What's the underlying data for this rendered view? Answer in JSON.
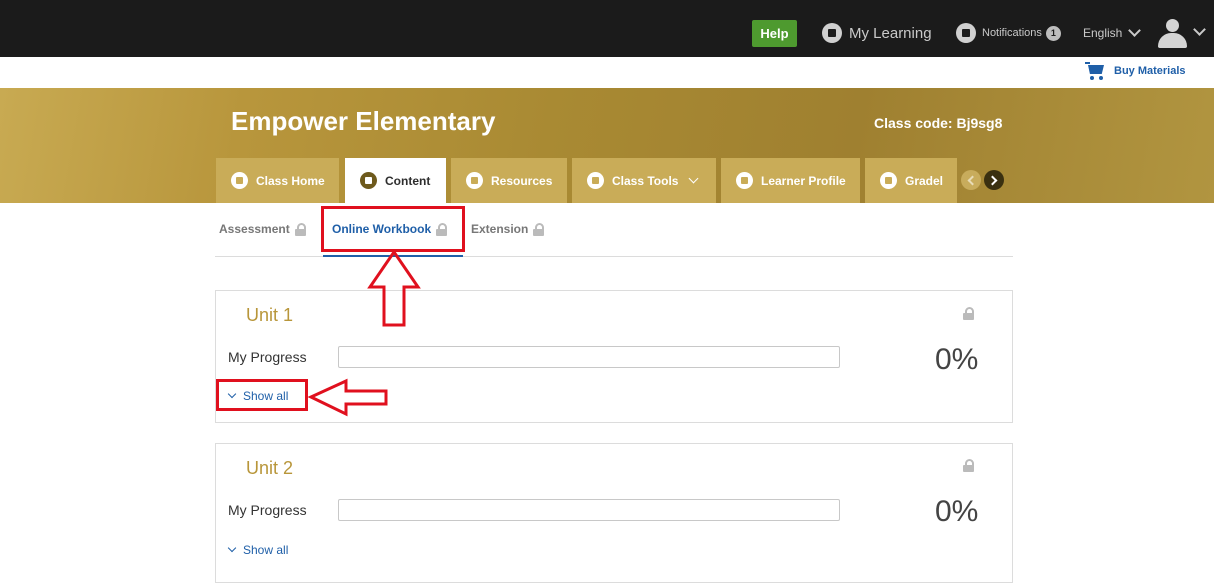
{
  "topbar": {
    "help_label": "Help",
    "mylearning_label": "My Learning",
    "notifications_label": "Notifications",
    "notifications_count": "1",
    "language_label": "English"
  },
  "buy_materials_label": "Buy Materials",
  "class": {
    "title": "Empower Elementary",
    "code_label": "Class code: Bj9sg8"
  },
  "tabs": [
    {
      "label": "Class Home"
    },
    {
      "label": "Content"
    },
    {
      "label": "Resources"
    },
    {
      "label": "Class Tools"
    },
    {
      "label": "Learner Profile"
    },
    {
      "label": "Gradel"
    }
  ],
  "subtabs": [
    {
      "label": "Assessment"
    },
    {
      "label": "Online Workbook"
    },
    {
      "label": "Extension"
    }
  ],
  "units": [
    {
      "title": "Unit 1",
      "progress_label": "My Progress",
      "progress_value": 0,
      "percent": "0%",
      "show_all": "Show all"
    },
    {
      "title": "Unit 2",
      "progress_label": "My Progress",
      "progress_value": 0,
      "percent": "0%",
      "show_all": "Show all"
    }
  ],
  "colors": {
    "topbar": "#1b1b1b",
    "help_button": "#4e9a2f",
    "gold_accent": "#b8963a",
    "link_blue": "#1f5fa8",
    "annotation_red": "#e0101e"
  },
  "icons": [
    "my-learning-icon",
    "notifications-icon",
    "avatar-icon",
    "cart-icon",
    "home-icon",
    "content-icon",
    "resources-icon",
    "class-tools-icon",
    "learner-profile-icon",
    "gradebook-icon",
    "lock-icon",
    "up-arrow-annotation",
    "left-arrow-annotation"
  ]
}
